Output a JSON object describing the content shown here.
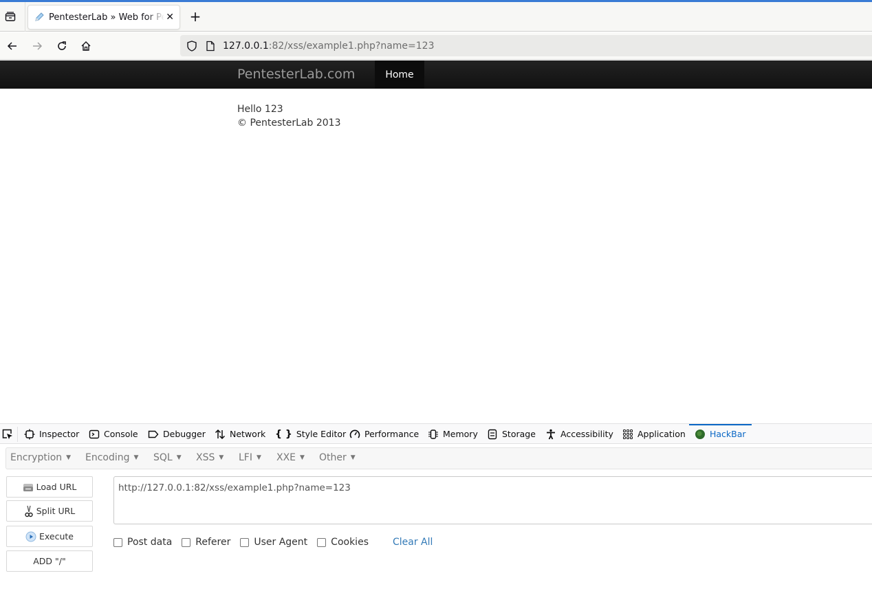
{
  "browser": {
    "tab": {
      "title": "PentesterLab » Web for Pentester",
      "close_icon": "close-icon",
      "favicon": "pencil-icon"
    },
    "new_tab_label": "+",
    "nav": {
      "back_icon": "arrow-left-icon",
      "forward_icon": "arrow-right-icon",
      "reload_icon": "reload-icon",
      "home_icon": "home-icon"
    },
    "url": {
      "host": "127.0.0.1",
      "rest": ":82/xss/example1.php?name=123"
    },
    "accent_color": "#3a7bd5"
  },
  "site": {
    "brand": "PentesterLab.com",
    "nav_items": [
      {
        "label": "Home",
        "active": true
      }
    ],
    "greeting": "Hello 123",
    "footer": "© PentesterLab 2013"
  },
  "devtools": {
    "tabs": [
      {
        "label": "Inspector",
        "icon": "inspector-icon"
      },
      {
        "label": "Console",
        "icon": "console-icon"
      },
      {
        "label": "Debugger",
        "icon": "debugger-icon"
      },
      {
        "label": "Network",
        "icon": "network-icon"
      },
      {
        "label": "Style Editor",
        "icon": "style-editor-icon"
      },
      {
        "label": "Performance",
        "icon": "performance-icon"
      },
      {
        "label": "Memory",
        "icon": "memory-icon"
      },
      {
        "label": "Storage",
        "icon": "storage-icon"
      },
      {
        "label": "Accessibility",
        "icon": "accessibility-icon"
      },
      {
        "label": "Application",
        "icon": "application-icon"
      },
      {
        "label": "HackBar",
        "icon": "hackbar-icon",
        "active": true
      }
    ],
    "active_color": "#0a67c5"
  },
  "hackbar": {
    "menus": [
      "Encryption",
      "Encoding",
      "SQL",
      "XSS",
      "LFI",
      "XXE",
      "Other"
    ],
    "buttons": {
      "load_url": "Load URL",
      "split_url": "Split URL",
      "execute": "Execute",
      "add_slash": "ADD \"/\""
    },
    "url_value": "http://127.0.0.1:82/xss/example1.php?name=123",
    "options": [
      {
        "label": "Post data",
        "checked": false
      },
      {
        "label": "Referer",
        "checked": false
      },
      {
        "label": "User Agent",
        "checked": false
      },
      {
        "label": "Cookies",
        "checked": false
      }
    ],
    "clear_all": "Clear All"
  }
}
